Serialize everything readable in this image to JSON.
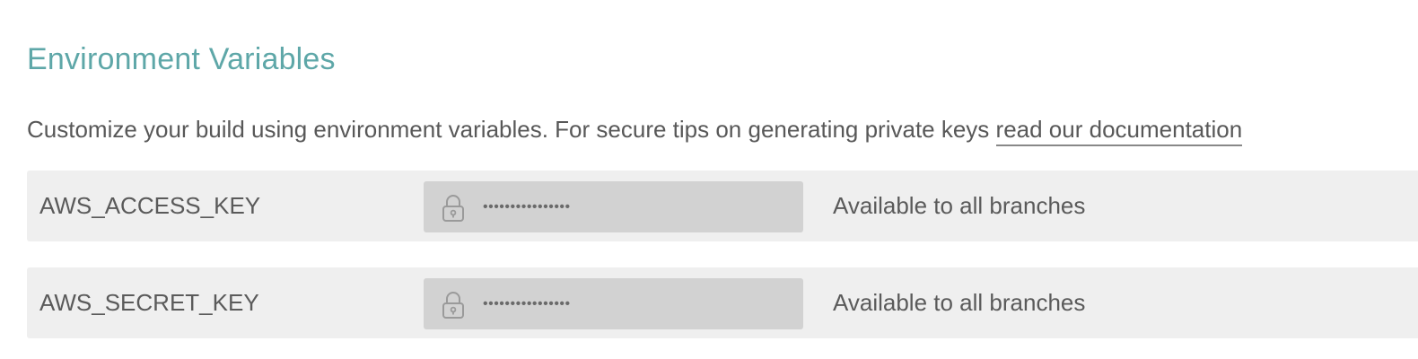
{
  "section": {
    "title": "Environment Variables",
    "description": "Customize your build using environment variables. For secure tips on generating private keys ",
    "link_label": "read our documentation"
  },
  "variables": [
    {
      "name": "AWS_ACCESS_KEY",
      "masked_value": "••••••••••••••••",
      "availability": "Available to all branches",
      "icon": "lock-icon"
    },
    {
      "name": "AWS_SECRET_KEY",
      "masked_value": "••••••••••••••••",
      "availability": "Available to all branches",
      "icon": "lock-icon"
    }
  ],
  "colors": {
    "title": "#5ea7a8",
    "text": "#5a5a5a",
    "row_background": "#efefef",
    "value_background": "#d2d2d2"
  }
}
